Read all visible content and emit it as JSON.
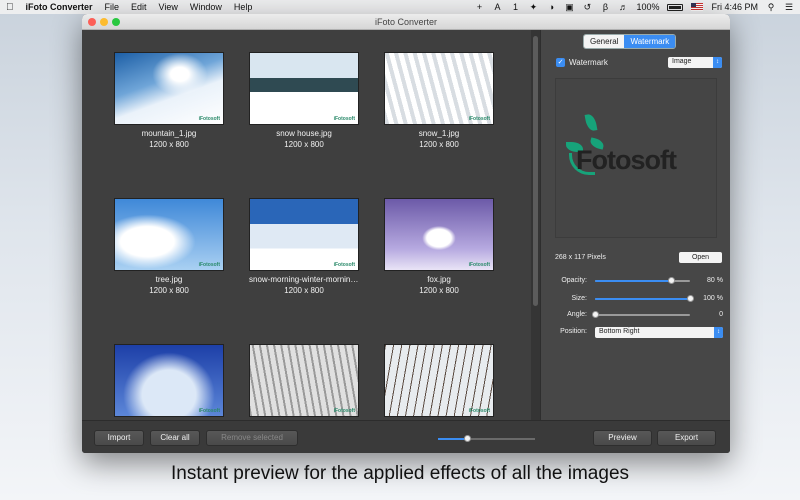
{
  "menubar": {
    "app_name": "iFoto Converter",
    "menus": [
      "File",
      "Edit",
      "View",
      "Window",
      "Help"
    ],
    "battery_text": "100%",
    "clock": "Fri 4:46 PM"
  },
  "window": {
    "title": "iFoto Converter"
  },
  "images": [
    {
      "name": "mountain_1.jpg",
      "size": "1200 x 800",
      "theme": "mountain"
    },
    {
      "name": "snow house.jpg",
      "size": "1200 x 800",
      "theme": "house"
    },
    {
      "name": "snow_1.jpg",
      "size": "1200 x 800",
      "theme": "forest"
    },
    {
      "name": "tree.jpg",
      "size": "1200 x 800",
      "theme": "tree"
    },
    {
      "name": "snow-morning-winter-morning-...",
      "size": "1200 x 800",
      "theme": "avenue"
    },
    {
      "name": "fox.jpg",
      "size": "1200 x 800",
      "theme": "fox"
    },
    {
      "name": "",
      "size": "",
      "theme": "frost"
    },
    {
      "name": "",
      "size": "",
      "theme": "gray"
    },
    {
      "name": "",
      "size": "",
      "theme": "path"
    }
  ],
  "watermark_text": "iFotosoft",
  "panel": {
    "tabs": [
      {
        "label": "General",
        "active": false
      },
      {
        "label": "Watermark",
        "active": true
      }
    ],
    "watermark_checkbox_label": "Watermark",
    "watermark_checked": true,
    "type_select": "Image",
    "logo_text": "Fotosoft",
    "pixels_label": "268 x 117 Pixels",
    "open_label": "Open",
    "opacity": {
      "label": "Opacity:",
      "value_text": "80 %",
      "value": 0.8
    },
    "size": {
      "label": "Size:",
      "value_text": "100 %",
      "value": 1.0
    },
    "angle": {
      "label": "Angle:",
      "value_text": "0",
      "value": 0
    },
    "position": {
      "label": "Position:",
      "value": "Bottom Right"
    }
  },
  "toolbar": {
    "import_label": "Import",
    "clear_label": "Clear all",
    "remove_label": "Remove selected",
    "preview_label": "Preview",
    "export_label": "Export",
    "zoom_value": 0.3
  },
  "colors": {
    "accent": "#3b8df2",
    "logo_green": "#17a37a"
  },
  "caption": "Instant preview for the applied effects of all the images"
}
